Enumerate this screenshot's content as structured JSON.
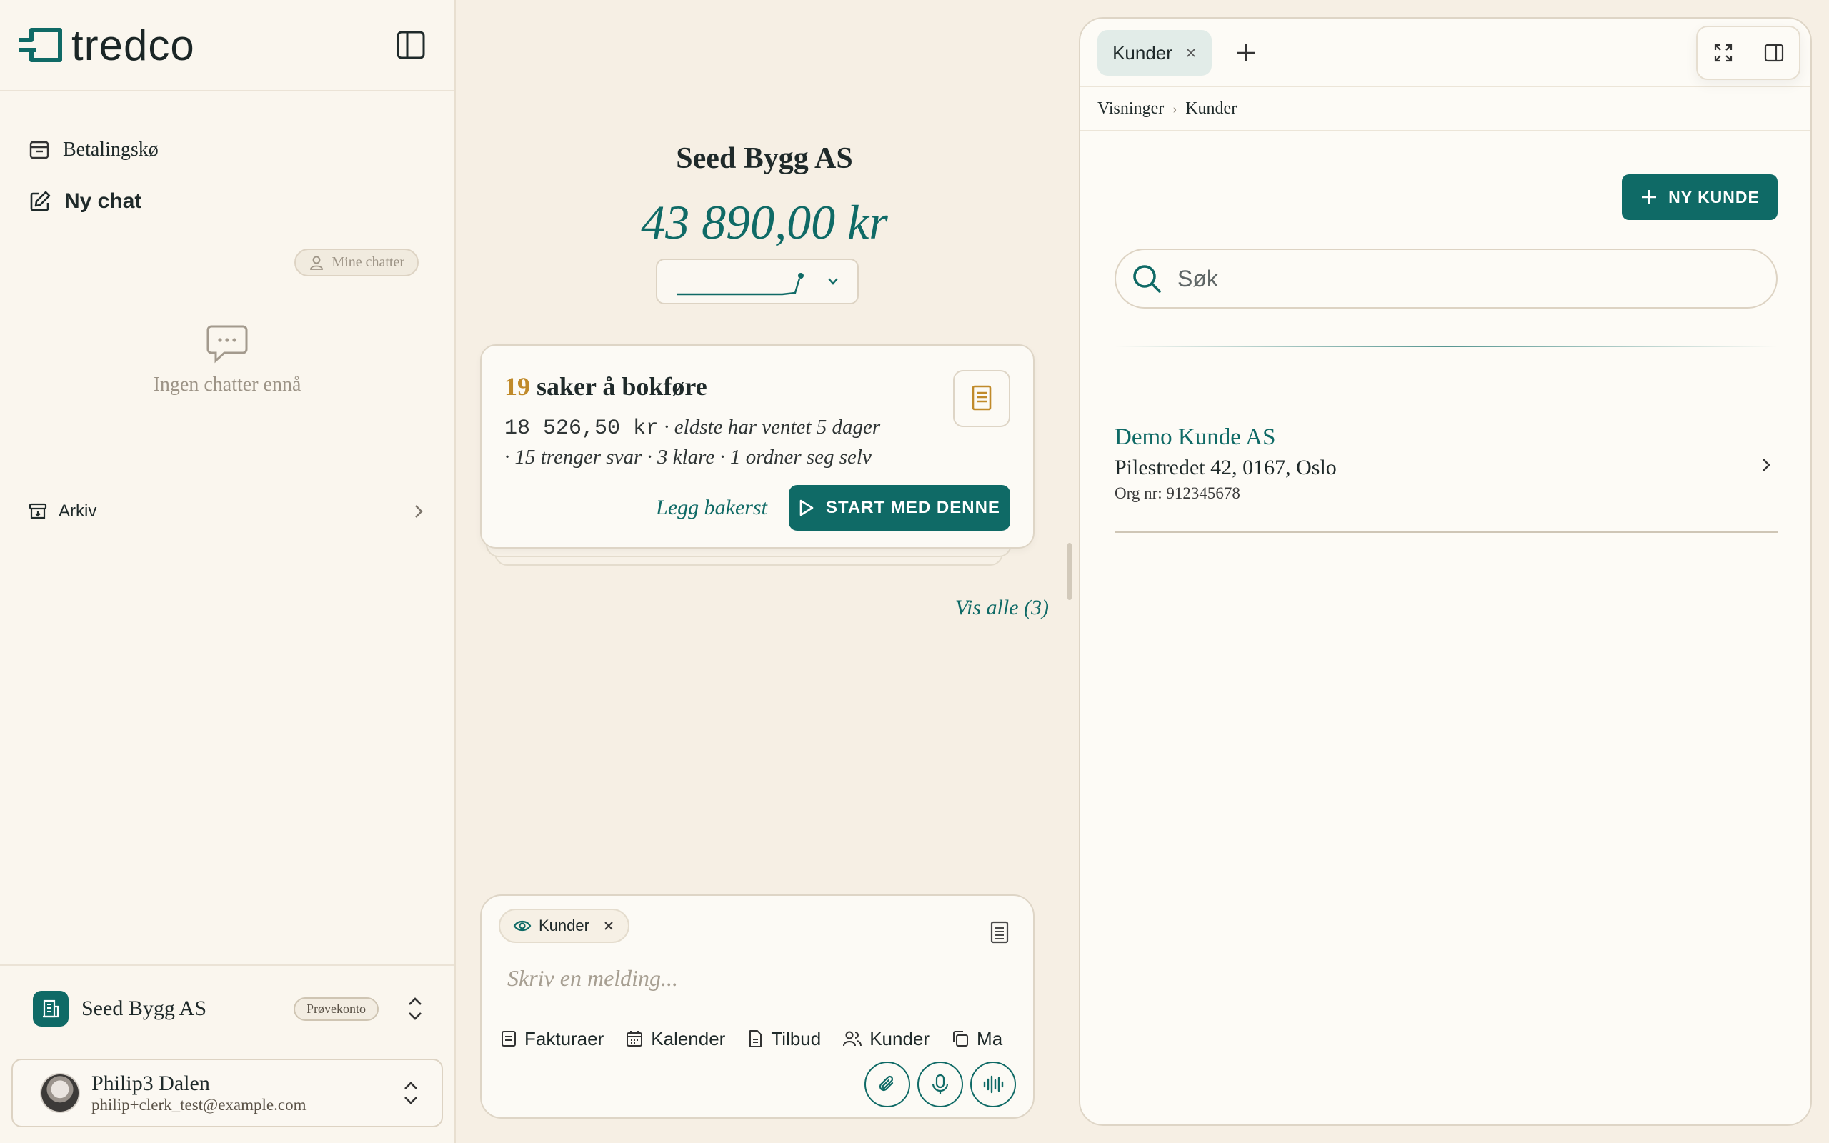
{
  "sidebar": {
    "logo_text": "tredco",
    "items": [
      {
        "label": "Betalingskø",
        "icon": "inbox-icon"
      },
      {
        "label": "Ny chat",
        "icon": "compose-icon"
      }
    ],
    "mine_chatter": "Mine chatter",
    "empty_text": "Ingen chatter ennå",
    "archive_label": "Arkiv",
    "company": {
      "name": "Seed Bygg AS",
      "badge": "Prøvekonto"
    },
    "user": {
      "name": "Philip3 Dalen",
      "email": "philip+clerk_test@example.com"
    }
  },
  "center": {
    "company_title": "Seed Bygg AS",
    "balance": "43 890,00 kr",
    "task": {
      "count": "19",
      "title": "saker å bokføre",
      "amount": "18 526,50 kr",
      "oldest": "· eldste har ventet 5 dager",
      "details": "· 15 trenger svar · 3 klare · 1 ordner seg selv",
      "later_label": "Legg bakerst",
      "start_label": "START MED DENNE"
    },
    "see_all": "Vis alle (3)",
    "composer": {
      "chip_label": "Kunder",
      "placeholder": "Skriv en melding...",
      "tools": [
        "Fakturaer",
        "Kalender",
        "Tilbud",
        "Kunder",
        "Ma"
      ]
    }
  },
  "panel": {
    "tab_label": "Kunder",
    "breadcrumb": [
      "Visninger",
      "Kunder"
    ],
    "new_button": "NY KUNDE",
    "search_placeholder": "Søk",
    "customers": [
      {
        "name": "Demo Kunde AS",
        "address": "Pilestredet 42, 0167, Oslo",
        "org": "Org nr: 912345678"
      }
    ]
  },
  "colors": {
    "accent": "#0f6a66",
    "background": "#f6efe4",
    "count_highlight": "#c08a2a"
  }
}
